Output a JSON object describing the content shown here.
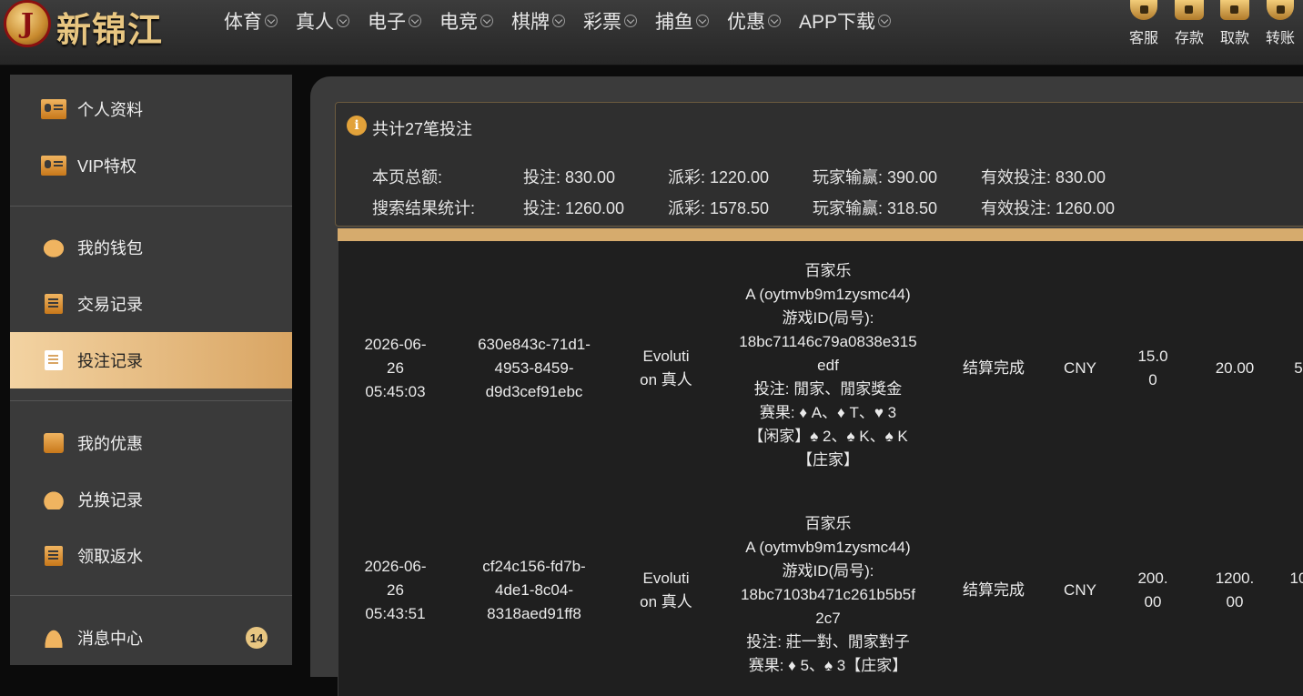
{
  "brand": {
    "logo_letter": "J",
    "name": "新锦江"
  },
  "nav": [
    {
      "label": "体育"
    },
    {
      "label": "真人"
    },
    {
      "label": "电子"
    },
    {
      "label": "电竞"
    },
    {
      "label": "棋牌"
    },
    {
      "label": "彩票"
    },
    {
      "label": "捕鱼"
    },
    {
      "label": "优惠"
    },
    {
      "label": "APP下载"
    }
  ],
  "quick": [
    {
      "label": "客服",
      "icon": "support-icon"
    },
    {
      "label": "存款",
      "icon": "deposit-icon"
    },
    {
      "label": "取款",
      "icon": "withdraw-icon"
    },
    {
      "label": "转账",
      "icon": "transfer-icon"
    }
  ],
  "sidebar": {
    "items": [
      {
        "label": "个人资料",
        "icon": "profile-card-icon"
      },
      {
        "label": "VIP特权",
        "icon": "vip-card-icon"
      },
      {
        "label": "我的钱包",
        "icon": "piggy-bank-icon"
      },
      {
        "label": "交易记录",
        "icon": "transaction-doc-icon"
      },
      {
        "label": "投注记录",
        "icon": "bet-record-doc-icon"
      },
      {
        "label": "我的优惠",
        "icon": "gift-bag-icon"
      },
      {
        "label": "兑换记录",
        "icon": "money-bag-icon"
      },
      {
        "label": "领取返水",
        "icon": "rebate-doc-icon"
      },
      {
        "label": "消息中心",
        "icon": "bell-icon"
      }
    ],
    "message_badge": "14",
    "active": "投注记录"
  },
  "summary": {
    "title": "共计27笔投注",
    "info_icon": "i",
    "page_total": {
      "label": "本页总额:",
      "bet": "投注: 830.00",
      "payout": "派彩: 1220.00",
      "win_loss": "玩家输赢: 390.00",
      "valid_bet": "有效投注: 830.00"
    },
    "search_total": {
      "label": "搜索结果统计:",
      "bet": "投注: 1260.00",
      "payout": "派彩: 1578.50",
      "win_loss": "玩家输赢: 318.50",
      "valid_bet": "有效投注: 1260.00"
    }
  },
  "rows": [
    {
      "time": [
        "2026-06-",
        "26",
        "05:45:03"
      ],
      "order_id": [
        "630e843c-71d1-",
        "4953-8459-",
        "d9d3cef91ebc"
      ],
      "platform": [
        "Evoluti",
        "on 真人"
      ],
      "detail": [
        "百家乐",
        "A (oytmvb9m1zysmc44)",
        "游戏ID(局号):",
        "18bc71146c79a0838e315",
        "edf",
        "投注: 閒家、閒家獎金",
        "赛果: ♦ A、♦ T、♥ 3",
        "【闲家】♠ 2、♠ K、♠ K",
        "【庄家】"
      ],
      "status": "结算完成",
      "currency": "CNY",
      "bet": [
        "15.0",
        "0"
      ],
      "payout": "20.00",
      "extra": "5"
    },
    {
      "time": [
        "2026-06-",
        "26",
        "05:43:51"
      ],
      "order_id": [
        "cf24c156-fd7b-",
        "4de1-8c04-",
        "8318aed91ff8"
      ],
      "platform": [
        "Evoluti",
        "on 真人"
      ],
      "detail": [
        "百家乐",
        "A (oytmvb9m1zysmc44)",
        "游戏ID(局号):",
        "18bc7103b471c261b5b5f",
        "2c7",
        "投注: 莊一對、閒家對子",
        "赛果: ♦ 5、♠ 3【庄家】"
      ],
      "status": "结算完成",
      "currency": "CNY",
      "bet": [
        "200.",
        "00"
      ],
      "payout": [
        "1200.",
        "00"
      ],
      "extra": "10"
    }
  ]
}
